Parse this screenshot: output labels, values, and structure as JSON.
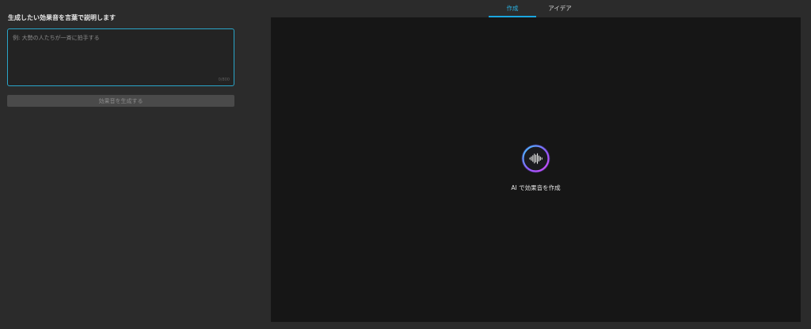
{
  "left_panel": {
    "prompt_label": "生成したい効果音を言葉で説明します",
    "textarea": {
      "value": "",
      "placeholder": "例: 大勢の人たちが一斉に拍手する",
      "counter": "0/800"
    },
    "generate_button_label": "効果音を生成する"
  },
  "tabs": [
    {
      "label": "作成",
      "active": true
    },
    {
      "label": "アイデア",
      "active": false
    }
  ],
  "preview": {
    "icon": "sound-wave-icon",
    "caption": "AI で効果音を作成"
  },
  "colors": {
    "accent": "#1aa6e0",
    "focus_border": "#2aa6c9",
    "background": "#2b2b2b",
    "preview_background": "#161616",
    "logo_ring_start": "#3ec6ff",
    "logo_ring_end": "#c44bff"
  }
}
